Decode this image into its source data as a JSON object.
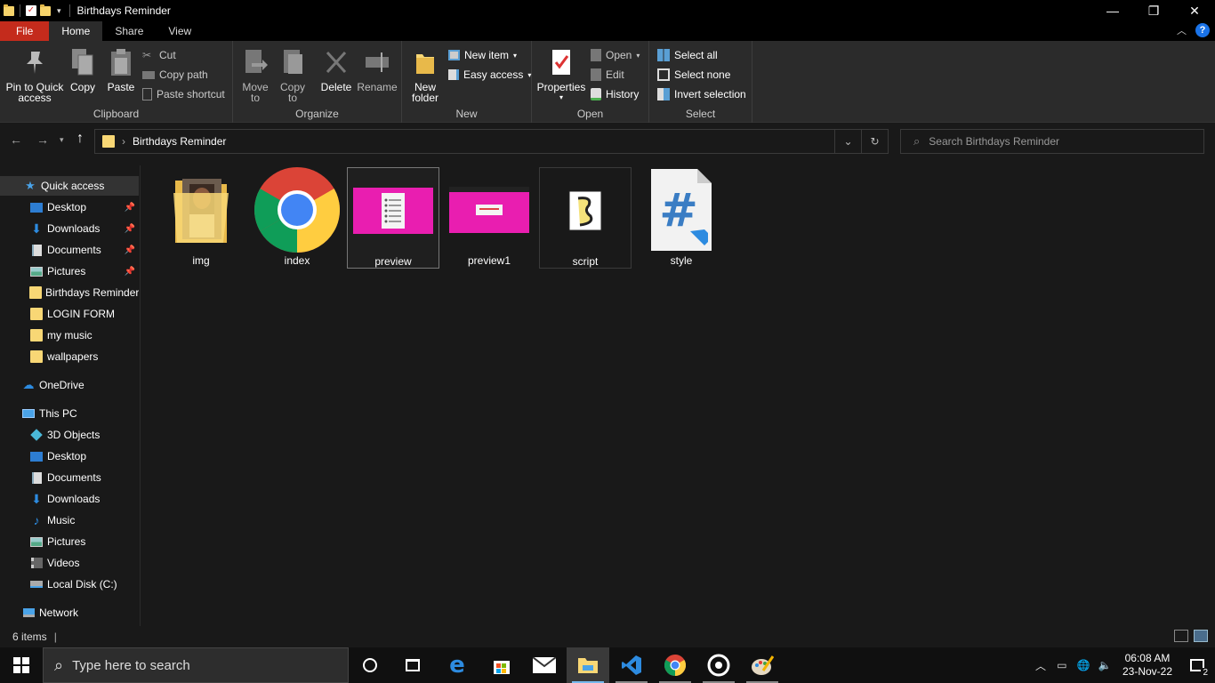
{
  "window": {
    "title": "Birthdays Reminder",
    "minimize_glyph": "—",
    "restore_glyph": "❐",
    "close_glyph": "✕"
  },
  "tabs": {
    "file": "File",
    "home": "Home",
    "share": "Share",
    "view": "View"
  },
  "ribbon": {
    "clipboard": {
      "label": "Clipboard",
      "pin_line1": "Pin to Quick",
      "pin_line2": "access",
      "copy": "Copy",
      "paste": "Paste",
      "cut": "Cut",
      "copy_path": "Copy path",
      "paste_shortcut": "Paste shortcut"
    },
    "organize": {
      "label": "Organize",
      "move_to_1": "Move",
      "move_to_2": "to",
      "copy_to_1": "Copy",
      "copy_to_2": "to",
      "delete": "Delete",
      "rename": "Rename"
    },
    "new": {
      "label": "New",
      "new_folder_1": "New",
      "new_folder_2": "folder",
      "new_item": "New item",
      "easy_access": "Easy access"
    },
    "open": {
      "label": "Open",
      "properties": "Properties",
      "open": "Open",
      "edit": "Edit",
      "history": "History"
    },
    "select": {
      "label": "Select",
      "select_all": "Select all",
      "select_none": "Select none",
      "invert": "Invert selection"
    }
  },
  "address": {
    "path": "Birthdays Reminder"
  },
  "search": {
    "placeholder": "Search Birthdays Reminder"
  },
  "navpane": {
    "quick_access": "Quick access",
    "quick_items": [
      {
        "label": "Desktop"
      },
      {
        "label": "Downloads"
      },
      {
        "label": "Documents"
      },
      {
        "label": "Pictures"
      },
      {
        "label": "Birthdays Reminder"
      },
      {
        "label": "LOGIN FORM"
      },
      {
        "label": "my music"
      },
      {
        "label": "wallpapers"
      }
    ],
    "onedrive": "OneDrive",
    "this_pc": "This PC",
    "pc_items": [
      {
        "label": "3D Objects"
      },
      {
        "label": "Desktop"
      },
      {
        "label": "Documents"
      },
      {
        "label": "Downloads"
      },
      {
        "label": "Music"
      },
      {
        "label": "Pictures"
      },
      {
        "label": "Videos"
      },
      {
        "label": "Local Disk (C:)"
      }
    ],
    "network": "Network"
  },
  "files": [
    {
      "name": "img"
    },
    {
      "name": "index"
    },
    {
      "name": "preview"
    },
    {
      "name": "preview1"
    },
    {
      "name": "script"
    },
    {
      "name": "style"
    }
  ],
  "status": {
    "count": "6 items"
  },
  "taskbar": {
    "search_placeholder": "Type here to search",
    "time": "06:08 AM",
    "date": "23-Nov-22",
    "notifications": "2"
  },
  "colors": {
    "accent": "#c42b1c",
    "selection": "#333333",
    "folder": "#f8d775",
    "pink": "#e91eb0"
  }
}
